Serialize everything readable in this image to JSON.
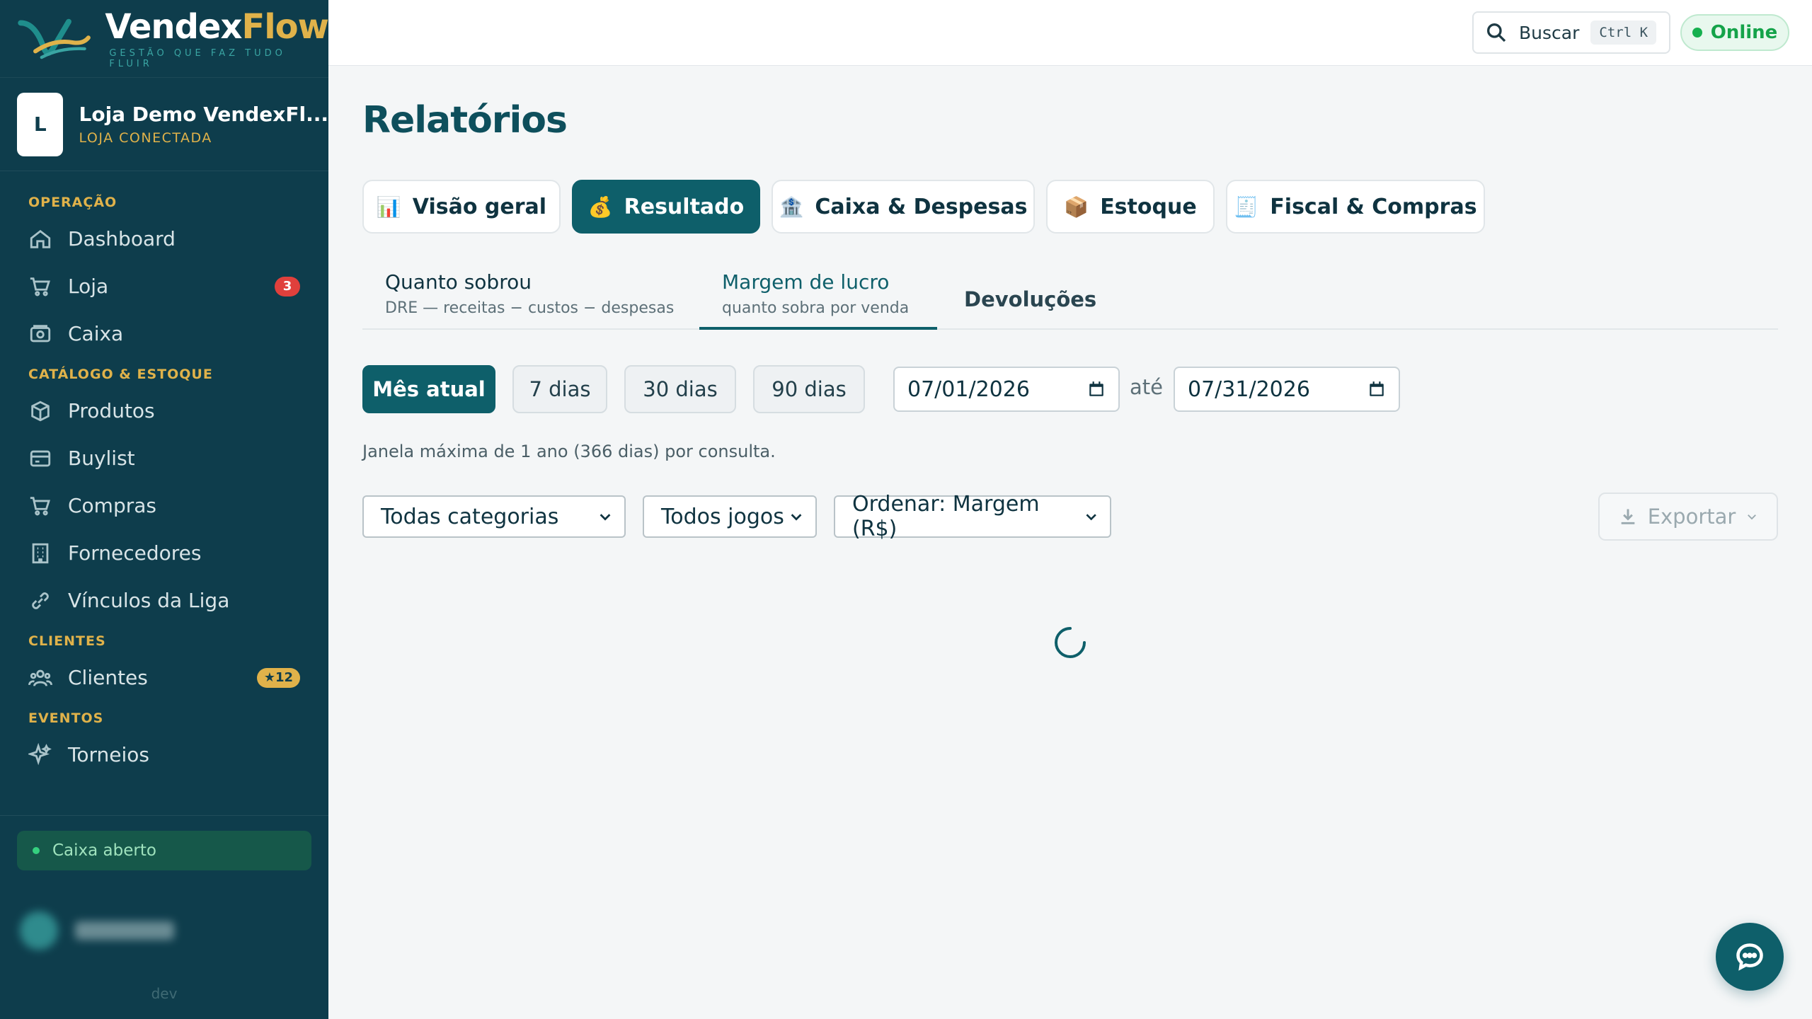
{
  "brand": {
    "name_part1": "Vendex",
    "name_part2": "Flow",
    "tagline": "GESTÃO QUE FAZ TUDO FLUIR"
  },
  "store": {
    "initial": "L",
    "name": "Loja Demo VendexFl...",
    "status": "LOJA CONECTADA"
  },
  "sidebar": {
    "sections": [
      {
        "title": "OPERAÇÃO"
      },
      {
        "title": "CATÁLOGO & ESTOQUE"
      },
      {
        "title": "CLIENTES"
      },
      {
        "title": "EVENTOS"
      }
    ],
    "items": [
      {
        "label": "Dashboard",
        "icon": "home-icon"
      },
      {
        "label": "Loja",
        "icon": "cart-icon",
        "badge": "3"
      },
      {
        "label": "Caixa",
        "icon": "cash-register-icon"
      },
      {
        "label": "Produtos",
        "icon": "box-icon"
      },
      {
        "label": "Buylist",
        "icon": "card-icon"
      },
      {
        "label": "Compras",
        "icon": "cart-icon"
      },
      {
        "label": "Fornecedores",
        "icon": "building-icon"
      },
      {
        "label": "Vínculos da Liga",
        "icon": "link-icon"
      },
      {
        "label": "Clientes",
        "icon": "users-icon",
        "badge": "★12"
      },
      {
        "label": "Torneios",
        "icon": "sparkles-icon"
      }
    ],
    "cash_status": "Caixa aberto",
    "env": "dev"
  },
  "topbar": {
    "search_label": "Buscar",
    "search_shortcut": "Ctrl K",
    "status": "Online"
  },
  "page": {
    "title": "Relatórios"
  },
  "tabs": [
    {
      "label": "Visão geral",
      "emoji": "📊"
    },
    {
      "label": "Resultado",
      "emoji": "💰",
      "active": true
    },
    {
      "label": "Caixa & Despesas",
      "emoji": "🏦"
    },
    {
      "label": "Estoque",
      "emoji": "📦"
    },
    {
      "label": "Fiscal & Compras",
      "emoji": "🧾"
    }
  ],
  "subtabs": [
    {
      "title": "Quanto sobrou",
      "subtitle": "DRE — receitas − custos − despesas"
    },
    {
      "title": "Margem de lucro",
      "subtitle": "quanto sobra por venda",
      "active": true
    },
    {
      "title": "Devoluções"
    }
  ],
  "range_buttons": [
    {
      "label": "Mês atual",
      "active": true
    },
    {
      "label": "7 dias"
    },
    {
      "label": "30 dias"
    },
    {
      "label": "90 dias"
    }
  ],
  "date_from": "07/01/2026",
  "date_sep": "até",
  "date_to": "07/31/2026",
  "hint": "Janela máxima de 1 ano (366 dias) por consulta.",
  "filters": {
    "category": "Todas categorias",
    "game": "Todos jogos",
    "sort": "Ordenar: Margem (R$)"
  },
  "export_label": "Exportar",
  "colors": {
    "primary": "#0e5f6a",
    "sidebar": "#0e3d4c",
    "accent": "#e0b24a",
    "online": "#16b04f"
  }
}
